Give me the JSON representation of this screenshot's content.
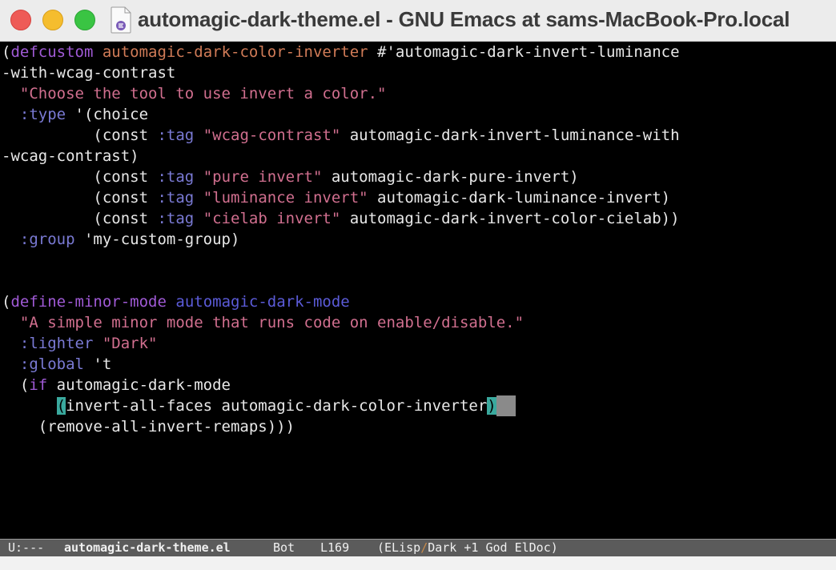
{
  "window": {
    "title": "automagic-dark-theme.el - GNU Emacs at sams-MacBook-Pro.local",
    "buttons": {
      "close": "close-window",
      "minimize": "minimize-window",
      "maximize": "zoom-window"
    },
    "file_icon": "emacs-file-icon"
  },
  "editor": {
    "lines": [
      "(defcustom automagic-dark-color-inverter #'automagic-dark-invert-luminance",
      "-with-wcag-contrast",
      "  \"Choose the tool to use invert a color.\"",
      "  :type '(choice",
      "          (const :tag \"wcag-contrast\" automagic-dark-invert-luminance-with",
      "-wcag-contrast)",
      "          (const :tag \"pure invert\" automagic-dark-pure-invert)",
      "          (const :tag \"luminance invert\" automagic-dark-luminance-invert)",
      "          (const :tag \"cielab invert\" automagic-dark-invert-color-cielab))",
      "  :group 'my-custom-group)",
      "",
      "",
      "(define-minor-mode automagic-dark-mode",
      "  \"A simple minor mode that runs code on enable/disable.\"",
      "  :lighter \"Dark\"",
      "  :global 't",
      "  (if automagic-dark-mode",
      "      (invert-all-faces automagic-dark-color-inverter)",
      "    (remove-all-invert-remaps)))"
    ]
  },
  "modeline": {
    "status": "U:---",
    "buffer_name": "automagic-dark-theme.el",
    "position": "Bot",
    "line": "L169",
    "modes_open": "(ELisp",
    "slash": "/",
    "modes_rest": "Dark +1 God ElDoc)"
  },
  "colors": {
    "keyword": "#a05ad6",
    "function_name": "#d07b57",
    "string": "#d16f8f",
    "keyword_symbol": "#7a7ad4",
    "mode_name": "#5b5bd8",
    "paren_match": "#3aa99e"
  }
}
